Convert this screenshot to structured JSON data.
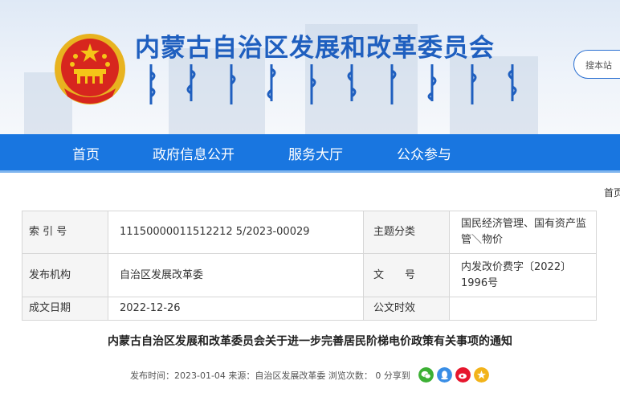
{
  "header": {
    "site_title": "内蒙古自治区发展和改革委员会",
    "search_placeholder": "搜本站"
  },
  "nav": {
    "items": [
      "首页",
      "政府信息公开",
      "服务大厅",
      "公众参与"
    ]
  },
  "breadcrumb": {
    "home": "首页"
  },
  "meta": {
    "index_label": "索 引 号",
    "index_value": "11150000011512212 5/2023-00029",
    "topic_label": "主题分类",
    "topic_value": "国民经济管理、国有资产监管＼物价",
    "issuer_label": "发布机构",
    "issuer_value": "自治区发展改革委",
    "docno_label": "文　　号",
    "docno_value": "内发改价费字〔2022〕1996号",
    "date_label": "成文日期",
    "date_value": "2022-12-26",
    "pubdate_label": "公文时效",
    "pubdate_value": ""
  },
  "document": {
    "title": "内蒙古自治区发展和改革委员会关于进一步完善居民阶梯电价政策有关事项的通知"
  },
  "info": {
    "text": "发布时间：2023-01-04   来源：自治区发展改革委   浏览次数：  0  分享到"
  },
  "share": [
    {
      "icon": "wechat-icon",
      "color": "#3cb034"
    },
    {
      "icon": "qq-icon",
      "color": "#3a8ee6"
    },
    {
      "icon": "weibo-icon",
      "color": "#e6162d"
    },
    {
      "icon": "qzone-icon",
      "color": "#f2b31a"
    }
  ]
}
